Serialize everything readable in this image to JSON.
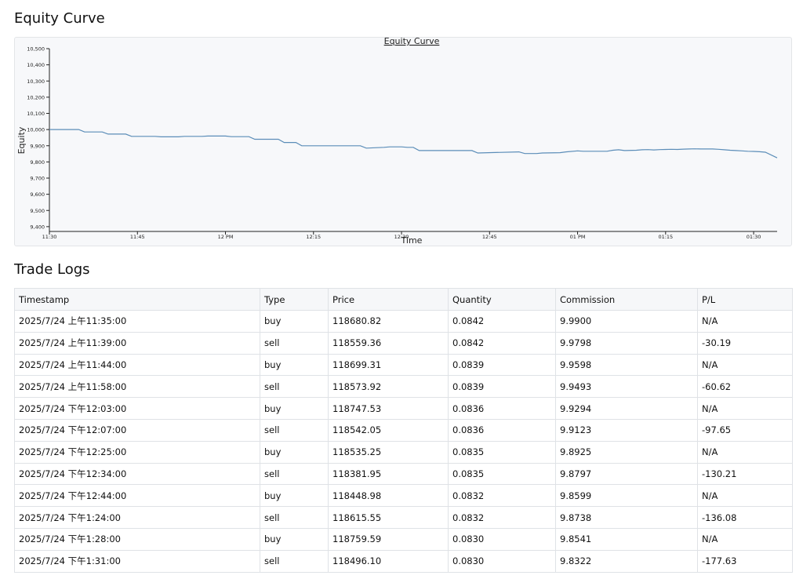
{
  "sections": {
    "equity_title": "Equity Curve",
    "logs_title": "Trade Logs"
  },
  "chart_data": {
    "type": "line",
    "title": "Equity Curve",
    "xlabel": "Time",
    "ylabel": "Equity",
    "x_ticks": [
      "11:30",
      "11:45",
      "12 PM",
      "12:15",
      "12:30",
      "12:45",
      "01 PM",
      "01:15",
      "01:30"
    ],
    "y_ticks": [
      "9,400",
      "9,500",
      "9,600",
      "9,700",
      "9,800",
      "9,900",
      "10,000",
      "10,100",
      "10,200",
      "10,300",
      "10,400",
      "10,500"
    ],
    "ylim": [
      9380,
      10500
    ],
    "xlim_minutes": [
      0,
      124
    ],
    "x_start": "11:30",
    "line_color": "#5b8db8",
    "series": [
      {
        "x": [
          0,
          5,
          6,
          9,
          10,
          13,
          14,
          18,
          19,
          22,
          23,
          26,
          27,
          30,
          31,
          34,
          35,
          39,
          40,
          42,
          43,
          44,
          45,
          46,
          47,
          50,
          51,
          53,
          54,
          57,
          58,
          60,
          61,
          62,
          63,
          65,
          66,
          68,
          69,
          72,
          73,
          80,
          81,
          83,
          84,
          87,
          88,
          90,
          91,
          95,
          96,
          97,
          98,
          100,
          101,
          102,
          103,
          104,
          105,
          106,
          107,
          108,
          109,
          110,
          111,
          112,
          113,
          114,
          115,
          116,
          117,
          118,
          119,
          120,
          121,
          122,
          124
        ],
        "y": [
          10000,
          10000,
          9985,
          9985,
          9972,
          9972,
          9958,
          9958,
          9955,
          9955,
          9958,
          9958,
          9960,
          9960,
          9956,
          9956,
          9940,
          9940,
          9920,
          9920,
          9900,
          9900,
          9900,
          9900,
          9900,
          9900,
          9900,
          9900,
          9885,
          9890,
          9893,
          9893,
          9890,
          9890,
          9870,
          9870,
          9870,
          9870,
          9870,
          9870,
          9855,
          9862,
          9852,
          9852,
          9855,
          9857,
          9862,
          9868,
          9866,
          9866,
          9872,
          9875,
          9870,
          9872,
          9875,
          9876,
          9874,
          9876,
          9877,
          9878,
          9877,
          9879,
          9880,
          9881,
          9880,
          9880,
          9880,
          9878,
          9875,
          9872,
          9870,
          9868,
          9866,
          9865,
          9863,
          9860,
          9825
        ]
      }
    ]
  },
  "table": {
    "headers": [
      "Timestamp",
      "Type",
      "Price",
      "Quantity",
      "Commission",
      "P/L"
    ],
    "rows": [
      [
        "2025/7/24 上午11:35:00",
        "buy",
        "118680.82",
        "0.0842",
        "9.9900",
        "N/A"
      ],
      [
        "2025/7/24 上午11:39:00",
        "sell",
        "118559.36",
        "0.0842",
        "9.9798",
        "-30.19"
      ],
      [
        "2025/7/24 上午11:44:00",
        "buy",
        "118699.31",
        "0.0839",
        "9.9598",
        "N/A"
      ],
      [
        "2025/7/24 上午11:58:00",
        "sell",
        "118573.92",
        "0.0839",
        "9.9493",
        "-60.62"
      ],
      [
        "2025/7/24 下午12:03:00",
        "buy",
        "118747.53",
        "0.0836",
        "9.9294",
        "N/A"
      ],
      [
        "2025/7/24 下午12:07:00",
        "sell",
        "118542.05",
        "0.0836",
        "9.9123",
        "-97.65"
      ],
      [
        "2025/7/24 下午12:25:00",
        "buy",
        "118535.25",
        "0.0835",
        "9.8925",
        "N/A"
      ],
      [
        "2025/7/24 下午12:34:00",
        "sell",
        "118381.95",
        "0.0835",
        "9.8797",
        "-130.21"
      ],
      [
        "2025/7/24 下午12:44:00",
        "buy",
        "118448.98",
        "0.0832",
        "9.8599",
        "N/A"
      ],
      [
        "2025/7/24 下午1:24:00",
        "sell",
        "118615.55",
        "0.0832",
        "9.8738",
        "-136.08"
      ],
      [
        "2025/7/24 下午1:28:00",
        "buy",
        "118759.59",
        "0.0830",
        "9.8541",
        "N/A"
      ],
      [
        "2025/7/24 下午1:31:00",
        "sell",
        "118496.10",
        "0.0830",
        "9.8322",
        "-177.63"
      ]
    ]
  }
}
